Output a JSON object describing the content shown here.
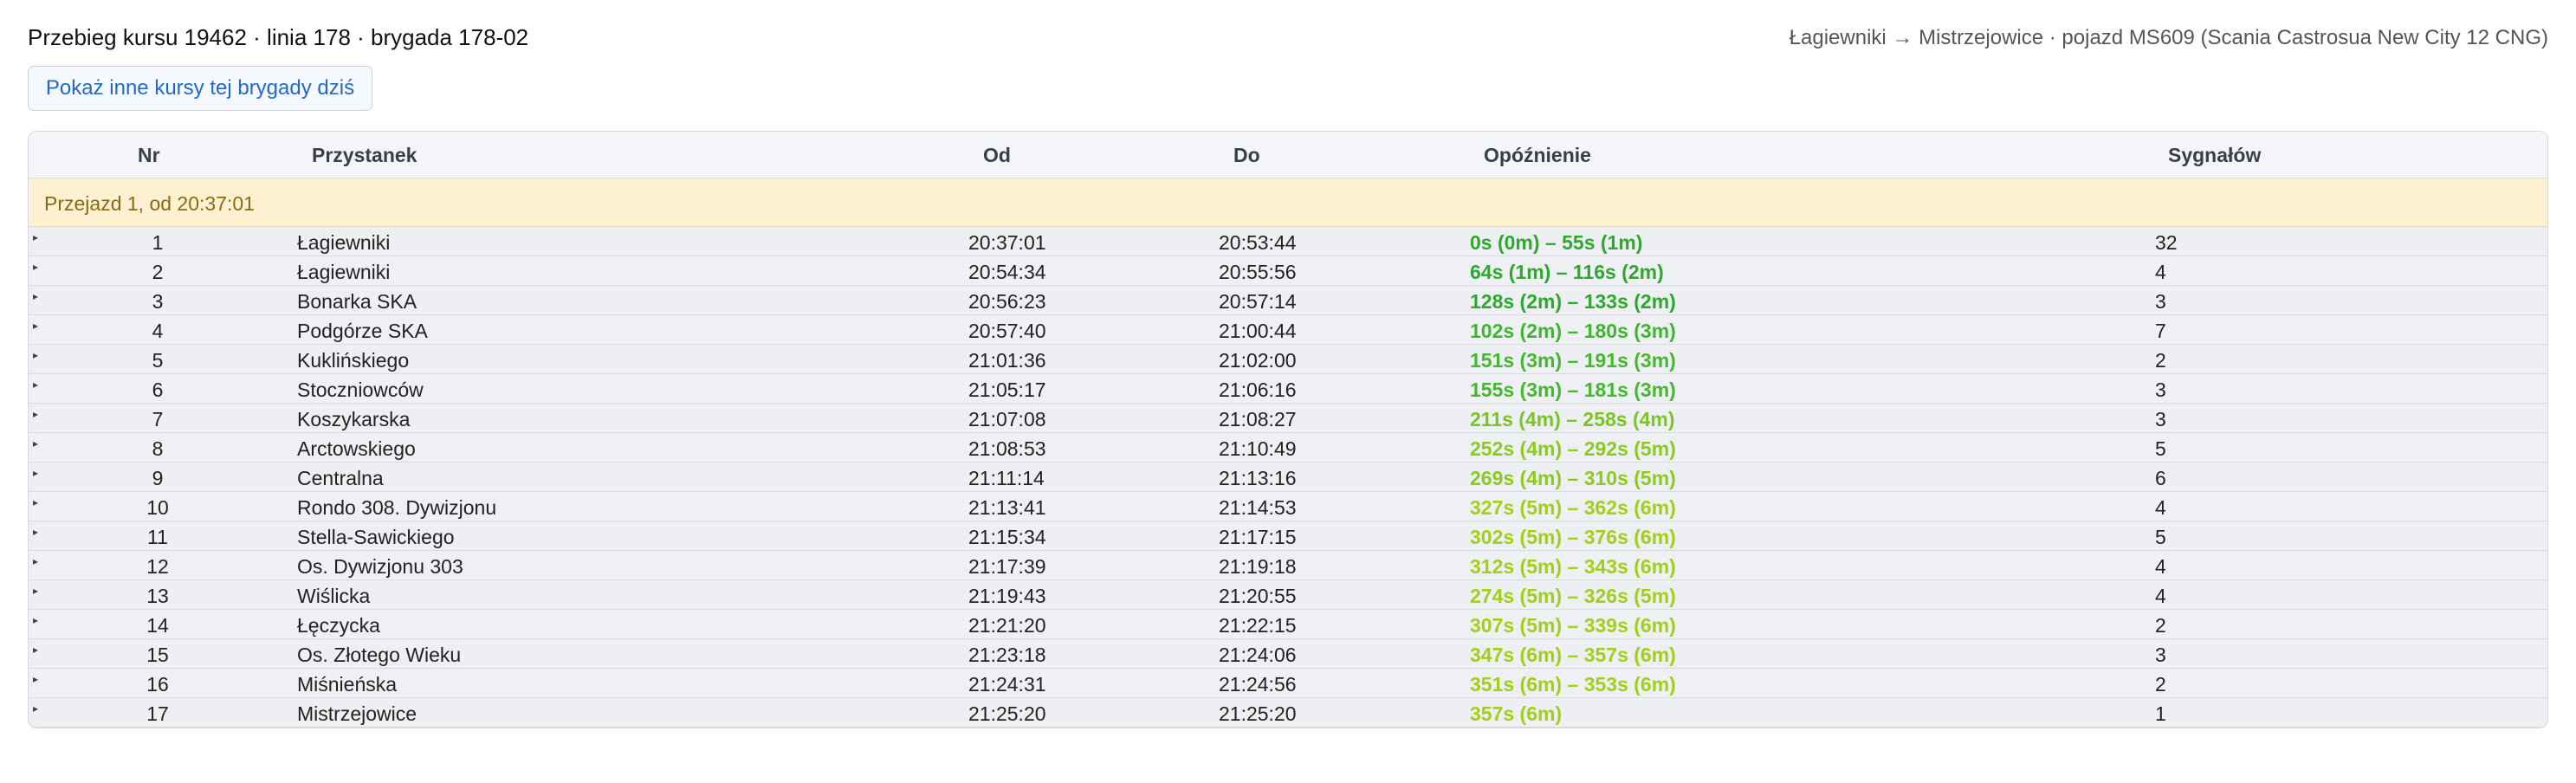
{
  "header": {
    "title": "Przebieg kursu 19462 · linia 178 · brygada 178-02",
    "subtitle": "Łagiewniki → Mistrzejowice · pojazd MS609 (Scania Castrosua New City 12 CNG)"
  },
  "actions": {
    "other_trips_label": "Pokaż inne kursy tej brygady dziś"
  },
  "table": {
    "columns": [
      "Nr",
      "Przystanek",
      "Od",
      "Do",
      "Opóźnienie",
      "Sygnałów"
    ],
    "trip_label": "Przejazd 1, od 20:37:01",
    "expand_icon": "▸",
    "rows": [
      {
        "nr": "1",
        "stop": "Łagiewniki",
        "from": "20:37:01",
        "to": "20:53:44",
        "delay": "0s (0m) – 55s (1m)",
        "color": "#2ea82e",
        "signals": "32"
      },
      {
        "nr": "2",
        "stop": "Łagiewniki",
        "from": "20:54:34",
        "to": "20:55:56",
        "delay": "64s (1m) – 116s (2m)",
        "color": "#2ea82e",
        "signals": "4"
      },
      {
        "nr": "3",
        "stop": "Bonarka SKA",
        "from": "20:56:23",
        "to": "20:57:14",
        "delay": "128s (2m) – 133s (2m)",
        "color": "#2ea82e",
        "signals": "3"
      },
      {
        "nr": "4",
        "stop": "Podgórze SKA",
        "from": "20:57:40",
        "to": "21:00:44",
        "delay": "102s (2m) – 180s (3m)",
        "color": "#3fb530",
        "signals": "7"
      },
      {
        "nr": "5",
        "stop": "Kuklińskiego",
        "from": "21:01:36",
        "to": "21:02:00",
        "delay": "151s (3m) – 191s (3m)",
        "color": "#45b830",
        "signals": "2"
      },
      {
        "nr": "6",
        "stop": "Stoczniowców",
        "from": "21:05:17",
        "to": "21:06:16",
        "delay": "155s (3m) – 181s (3m)",
        "color": "#45b830",
        "signals": "3"
      },
      {
        "nr": "7",
        "stop": "Koszykarska",
        "from": "21:07:08",
        "to": "21:08:27",
        "delay": "211s (4m) – 258s (4m)",
        "color": "#7cc425",
        "signals": "3"
      },
      {
        "nr": "8",
        "stop": "Arctowskiego",
        "from": "21:08:53",
        "to": "21:10:49",
        "delay": "252s (4m) – 292s (5m)",
        "color": "#8dca20",
        "signals": "5"
      },
      {
        "nr": "9",
        "stop": "Centralna",
        "from": "21:11:14",
        "to": "21:13:16",
        "delay": "269s (4m) – 310s (5m)",
        "color": "#8dca20",
        "signals": "6"
      },
      {
        "nr": "10",
        "stop": "Rondo 308. Dywizjonu",
        "from": "21:13:41",
        "to": "21:14:53",
        "delay": "327s (5m) – 362s (6m)",
        "color": "#a2cf1a",
        "signals": "4"
      },
      {
        "nr": "11",
        "stop": "Stella-Sawickiego",
        "from": "21:15:34",
        "to": "21:17:15",
        "delay": "302s (5m) – 376s (6m)",
        "color": "#a2cf1a",
        "signals": "5"
      },
      {
        "nr": "12",
        "stop": "Os. Dywizjonu 303",
        "from": "21:17:39",
        "to": "21:19:18",
        "delay": "312s (5m) – 343s (6m)",
        "color": "#a2cf1a",
        "signals": "4"
      },
      {
        "nr": "13",
        "stop": "Wiślicka",
        "from": "21:19:43",
        "to": "21:20:55",
        "delay": "274s (5m) – 326s (5m)",
        "color": "#a2cf1a",
        "signals": "4"
      },
      {
        "nr": "14",
        "stop": "Łęczycka",
        "from": "21:21:20",
        "to": "21:22:15",
        "delay": "307s (5m) – 339s (6m)",
        "color": "#a2cf1a",
        "signals": "2"
      },
      {
        "nr": "15",
        "stop": "Os. Złotego Wieku",
        "from": "21:23:18",
        "to": "21:24:06",
        "delay": "347s (6m) – 357s (6m)",
        "color": "#a2cf1a",
        "signals": "3"
      },
      {
        "nr": "16",
        "stop": "Miśnieńska",
        "from": "21:24:31",
        "to": "21:24:56",
        "delay": "351s (6m) – 353s (6m)",
        "color": "#a2cf1a",
        "signals": "2"
      },
      {
        "nr": "17",
        "stop": "Mistrzejowice",
        "from": "21:25:20",
        "to": "21:25:20",
        "delay": "357s (6m)",
        "color": "#a2cf1a",
        "signals": "1"
      }
    ]
  }
}
